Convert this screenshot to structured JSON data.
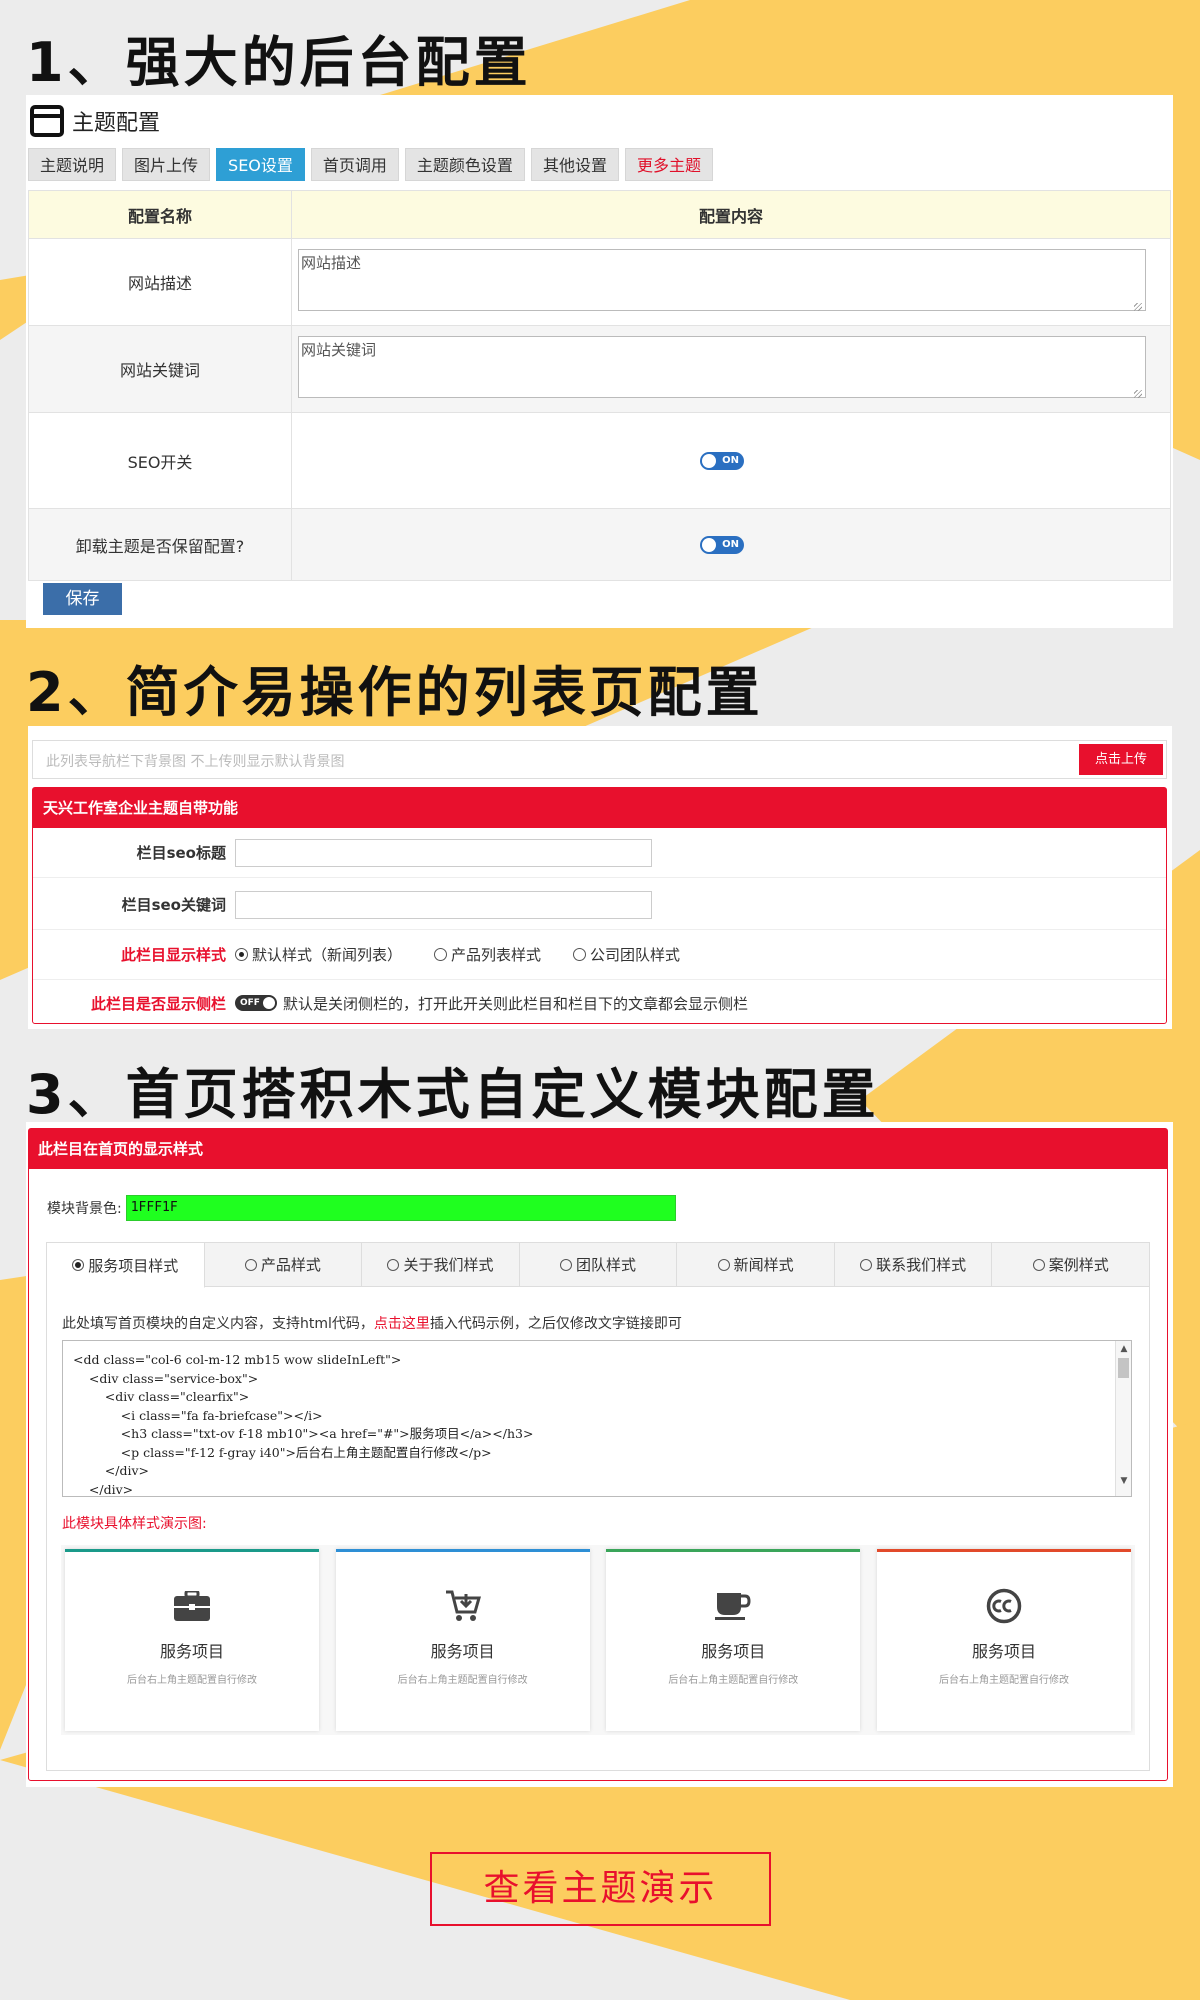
{
  "headings": {
    "h1": "1、强大的后台配置",
    "h2": "2、简介易操作的列表页配置",
    "h3": "3、首页搭积木式自定义模块配置"
  },
  "panel1": {
    "title": "主题配置",
    "tabs": [
      {
        "label": "主题说明"
      },
      {
        "label": "图片上传"
      },
      {
        "label": "SEO设置"
      },
      {
        "label": "首页调用"
      },
      {
        "label": "主题颜色设置"
      },
      {
        "label": "其他设置"
      },
      {
        "label": "更多主题"
      }
    ],
    "table": {
      "col_name": "配置名称",
      "col_content": "配置内容",
      "rows": [
        {
          "name": "网站描述",
          "value": "网站描述"
        },
        {
          "name": "网站关键词",
          "value": "网站关键词"
        },
        {
          "name": "SEO开关",
          "toggle": "ON"
        },
        {
          "name": "卸载主题是否保留配置?",
          "toggle": "ON"
        }
      ]
    },
    "save_label": "保存"
  },
  "panel2": {
    "upload_placeholder": "此列表导航栏下背景图 不上传则显示默认背景图",
    "upload_button": "点击上传",
    "box_title": "天兴工作室企业主题自带功能",
    "seo_title_label": "栏目seo标题",
    "seo_keywords_label": "栏目seo关键词",
    "display_style_label": "此栏目显示样式",
    "display_options": [
      "默认样式（新闻列表）",
      "产品列表样式",
      "公司团队样式"
    ],
    "sidebar_label": "此栏目是否显示侧栏",
    "sidebar_toggle": "OFF",
    "sidebar_note": "默认是关闭侧栏的，打开此开关则此栏目和栏目下的文章都会显示侧栏"
  },
  "panel3": {
    "box_title": "此栏目在首页的显示样式",
    "bg_label": "模块背景色:",
    "bg_value": "1FFF1F",
    "bg_color": "#1fff1f",
    "tabs": [
      "服务项目样式",
      "产品样式",
      "关于我们样式",
      "团队样式",
      "新闻样式",
      "联系我们样式",
      "案例样式"
    ],
    "hint_pre": "此处填写首页模块的自定义内容，支持html代码，",
    "hint_link": "点击这里",
    "hint_post": "插入代码示例，之后仅修改文字链接即可",
    "code": "<dd class=\"col-6 col-m-12 mb15 wow slideInLeft\">\n    <div class=\"service-box\">\n        <div class=\"clearfix\">\n            <i class=\"fa fa-briefcase\"></i>\n            <h3 class=\"txt-ov f-18 mb10\"><a href=\"#\">服务项目</a></h3>\n            <p class=\"f-12 f-gray i40\">后台右上角主题配置自行修改</p>\n        </div>\n    </div>",
    "demo_label": "此模块具体样式演示图:",
    "cards": [
      {
        "icon": "briefcase-icon",
        "title": "服务项目",
        "sub": "后台右上角主题配置自行修改",
        "accent": "#1a9a8a"
      },
      {
        "icon": "cart-icon",
        "title": "服务项目",
        "sub": "后台右上角主题配置自行修改",
        "accent": "#2e8fd5"
      },
      {
        "icon": "coffee-cup-icon",
        "title": "服务项目",
        "sub": "后台右上角主题配置自行修改",
        "accent": "#3aa55a"
      },
      {
        "icon": "creative-commons-icon",
        "title": "服务项目",
        "sub": "后台右上角主题配置自行修改",
        "accent": "#e24a2a"
      }
    ]
  },
  "demo_button": "查看主题演示",
  "colors": {
    "accent_red": "#e8102d",
    "tab_blue": "#2e9fd5",
    "background_yellow": "#fccd5f"
  }
}
